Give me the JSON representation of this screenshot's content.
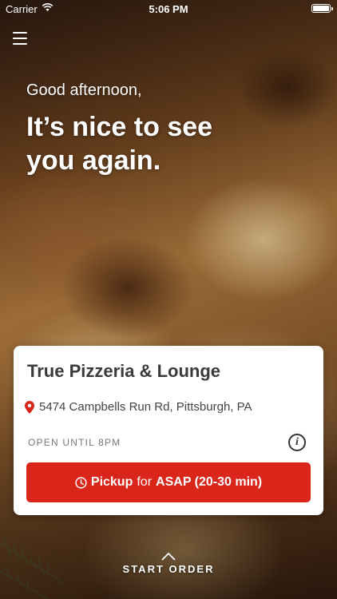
{
  "status_bar": {
    "carrier": "Carrier",
    "time": "5:06 PM"
  },
  "header": {
    "menu_icon": "hamburger-menu-icon"
  },
  "greeting": {
    "salutation": "Good afternoon,",
    "headline": "It’s nice to see you again."
  },
  "restaurant": {
    "name": "True Pizzeria & Lounge",
    "address": "5474 Campbells Run Rd, Pittsburgh, PA",
    "hours": "OPEN UNTIL 8PM",
    "pickup": {
      "mode": "Pickup",
      "connector": "for",
      "time": "ASAP (20-30 min)"
    }
  },
  "footer": {
    "start_order": "START ORDER"
  },
  "colors": {
    "accent": "#d9251a",
    "card_bg": "#ffffff",
    "text_dark": "#3a3a3a"
  }
}
